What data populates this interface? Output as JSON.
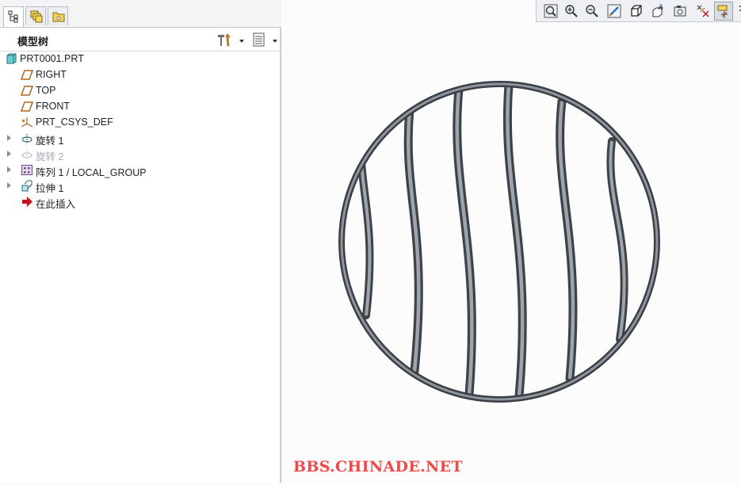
{
  "panel": {
    "tabs": [
      {
        "icon": "model-tree-tab-icon",
        "active": true
      },
      {
        "icon": "layers-tab-icon",
        "active": false
      },
      {
        "icon": "favorites-folder-tab-icon",
        "active": false
      }
    ],
    "title": "模型树",
    "header_buttons": [
      "settings-hammer-icon",
      "tree-columns-icon"
    ]
  },
  "tree": {
    "items": [
      {
        "label": "PRT0001.PRT",
        "icon": "part-icon",
        "expandable": false,
        "indent": 0,
        "suppressed": false
      },
      {
        "label": "RIGHT",
        "icon": "datum-plane-icon",
        "expandable": false,
        "indent": 1,
        "suppressed": false
      },
      {
        "label": "TOP",
        "icon": "datum-plane-icon",
        "expandable": false,
        "indent": 1,
        "suppressed": false
      },
      {
        "label": "FRONT",
        "icon": "datum-plane-icon",
        "expandable": false,
        "indent": 1,
        "suppressed": false
      },
      {
        "label": "PRT_CSYS_DEF",
        "icon": "coordinate-system-icon",
        "expandable": false,
        "indent": 1,
        "suppressed": false
      },
      {
        "label": "旋转 1",
        "icon": "revolve-icon",
        "expandable": true,
        "indent": 1,
        "suppressed": false
      },
      {
        "label": "旋转 2",
        "icon": "revolve-icon",
        "expandable": true,
        "indent": 1,
        "suppressed": true
      },
      {
        "label": "阵列 1 / LOCAL_GROUP",
        "icon": "pattern-icon",
        "expandable": true,
        "indent": 1,
        "suppressed": false
      },
      {
        "label": "拉伸 1",
        "icon": "extrude-icon",
        "expandable": true,
        "indent": 1,
        "suppressed": false
      },
      {
        "label": "在此插入",
        "icon": "insert-here-arrow-icon",
        "expandable": false,
        "indent": 1,
        "suppressed": false
      }
    ]
  },
  "toolbar": {
    "buttons": [
      "refit-icon",
      "zoom-in-icon",
      "zoom-out-icon",
      "repaint-icon",
      "display-style-icon",
      "saved-orientations-icon",
      "view-manager-icon",
      "datum-display-filter-icon",
      "spin-center-icon",
      "annotation-display-icon"
    ],
    "pressed": "spin-center-icon"
  },
  "viewport": {
    "background": "#fcfcfc",
    "model_color": "#5c6068",
    "watermark": "BBS.CHINADE.NET",
    "watermark_color": "#ee4a4a"
  }
}
